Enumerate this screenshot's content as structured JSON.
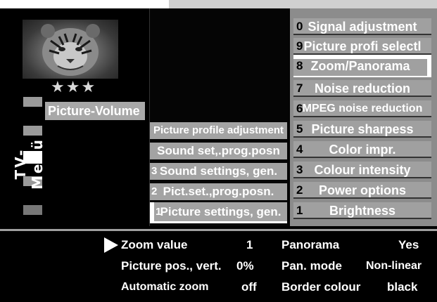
{
  "side_panel": {
    "stars": "★★★",
    "vertical_label": "TV-Menü",
    "picture_volume": "Picture-Volume"
  },
  "middle_menu": {
    "items": [
      {
        "num": "",
        "label": "Picture profile adjustment"
      },
      {
        "num": "",
        "label": "Sound set,.prog.posn"
      },
      {
        "num": "3",
        "label": "Sound settings, gen."
      },
      {
        "num": "2",
        "label": "Pict.set.,prog.posn."
      },
      {
        "num": "1",
        "label": "Picture settings, gen."
      }
    ]
  },
  "right_menu": {
    "items": [
      {
        "num": "0",
        "label": "Signal adjustment"
      },
      {
        "num": "9",
        "label": "Picture profi selectl"
      },
      {
        "num": "8",
        "label": "Zoom/Panorama"
      },
      {
        "num": "7",
        "label": "Noise reduction"
      },
      {
        "num": "6",
        "label": "MPEG noise reduction"
      },
      {
        "num": "5",
        "label": "Picture sharpess"
      },
      {
        "num": "4",
        "label": "Color impr."
      },
      {
        "num": "3",
        "label": "Colour intensity"
      },
      {
        "num": "2",
        "label": "Power options"
      },
      {
        "num": "1",
        "label": "Brightness"
      }
    ],
    "selected_index": 2
  },
  "settings": {
    "zoom_value_label": "Zoom value",
    "zoom_value": "1",
    "picture_pos_label": "Picture pos., vert.",
    "picture_pos_value": "0%",
    "automatic_zoom_label": "Automatic zoom",
    "automatic_zoom_value": "off",
    "panorama_label": "Panorama",
    "panorama_value": "Yes",
    "pan_mode_label": "Pan. mode",
    "pan_mode_value": "Non-linear",
    "border_colour_label": "Border colour",
    "border_colour_value": "black"
  },
  "colors": {
    "background": "#000000",
    "item_grey": "#a0a0a0",
    "highlight": "#ffffff"
  }
}
